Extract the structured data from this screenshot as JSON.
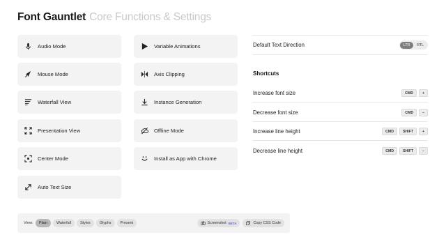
{
  "header": {
    "title": "Font Gauntlet",
    "subtitle": "Core Functions & Settings"
  },
  "modes_left": [
    {
      "label": "Audio Mode",
      "icon": "mic-icon"
    },
    {
      "label": "Mouse Mode",
      "icon": "cursor-icon"
    },
    {
      "label": "Waterfall View",
      "icon": "waterfall-icon"
    },
    {
      "label": "Presentation View",
      "icon": "fullscreen-icon"
    },
    {
      "label": "Center Mode",
      "icon": "center-icon"
    },
    {
      "label": "Auto Text Size",
      "icon": "resize-icon"
    }
  ],
  "modes_right": [
    {
      "label": "Variable Animations",
      "icon": "play-icon"
    },
    {
      "label": "Axis Clipping",
      "icon": "axis-clip-icon"
    },
    {
      "label": "Instance Generation",
      "icon": "download-icon"
    },
    {
      "label": "Offline Mode",
      "icon": "cloud-off-icon"
    },
    {
      "label": "Install as App with Chrome",
      "icon": "smiley-icon"
    }
  ],
  "settings": {
    "text_direction_label": "Default Text Direction",
    "directions": [
      "LTR",
      "RTL"
    ],
    "active_direction": "LTR"
  },
  "shortcuts": {
    "title": "Shortcuts",
    "items": [
      {
        "label": "Increase font size",
        "keys": [
          "CMD",
          "+"
        ]
      },
      {
        "label": "Decrease font size",
        "keys": [
          "CMD",
          "–"
        ]
      },
      {
        "label": "Increase line height",
        "keys": [
          "CMD",
          "SHIFT",
          "+"
        ]
      },
      {
        "label": "Decrease line height",
        "keys": [
          "CMD",
          "SHIFT",
          "–"
        ]
      }
    ]
  },
  "bottom_bar": {
    "view_label": "View:",
    "views": [
      "Plain",
      "Waterfall",
      "Styles",
      "Glyphs",
      "Present"
    ],
    "active_view": "Plain",
    "screenshot_label": "Screenshot",
    "beta_label": "BETA",
    "copy_css_label": "Copy CSS Code"
  }
}
